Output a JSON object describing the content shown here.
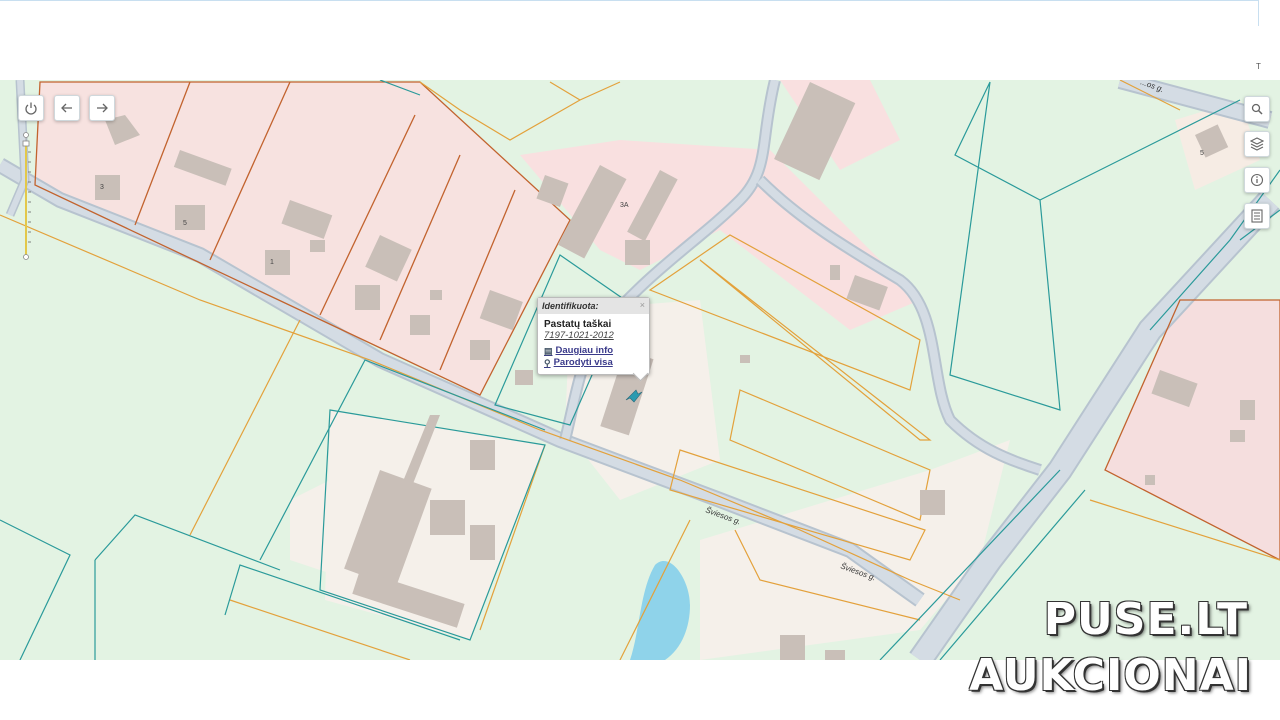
{
  "map": {
    "streets": {
      "street_a": "Šviesos g.",
      "street_b": "Šviesos g.",
      "street_c": "...os g."
    },
    "building_numbers": {
      "n1": "3A",
      "n2": "3",
      "n3": "5",
      "n4": "1",
      "n5": "5"
    },
    "colors": {
      "parcel_fill": "#e3f3e3",
      "residential_fill": "#f7d9d9",
      "building_fill": "#c9bfb8",
      "road_fill": "#d4dce4",
      "water_fill": "#8fd3ea",
      "orange_line": "#e3a13b",
      "teal_line": "#2a9a9a",
      "brown_line": "#c2632e"
    }
  },
  "left_toolbar": {
    "power_icon": "power-icon",
    "back_icon": "arrow-left-icon",
    "forward_icon": "arrow-right-icon"
  },
  "right_toolbar": {
    "search_icon": "search-icon",
    "layers_icon": "layers-icon",
    "info_icon": "info-icon",
    "legend_icon": "document-icon"
  },
  "popup": {
    "header": "Identifikuota:",
    "close": "×",
    "title": "Pastatų taškai",
    "id": "7197-1021-2012",
    "more_info": "Daugiau info",
    "show_all": "Parodyti visa"
  },
  "watermark": {
    "line1": "PUSE.LT",
    "line2": "AUKCIONAI"
  },
  "topbar": {
    "mark": "T"
  }
}
